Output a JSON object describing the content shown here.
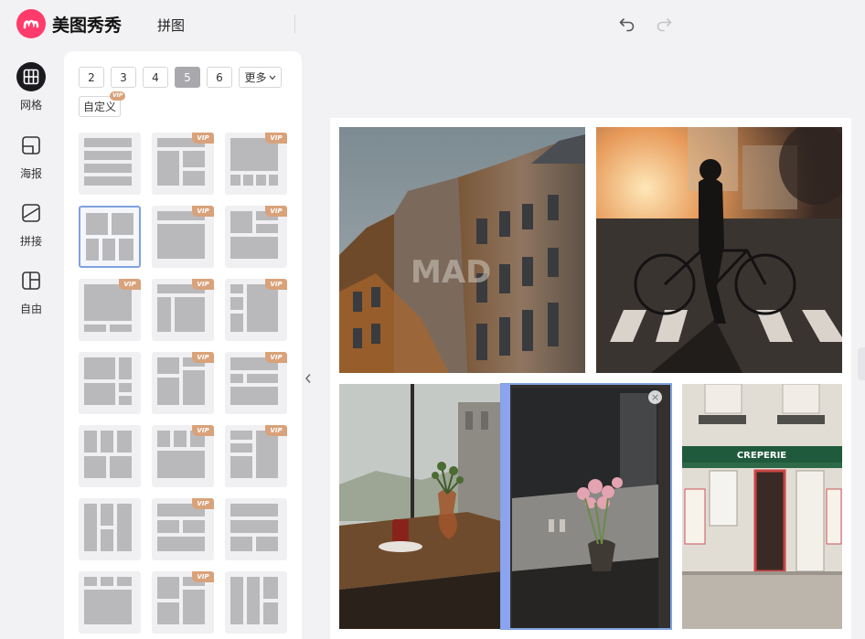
{
  "header": {
    "app_name": "美图秀秀",
    "page_title": "拼图",
    "undo_icon": "undo-icon",
    "redo_icon": "redo-icon",
    "logo_color": "#ff3b6b"
  },
  "nav": {
    "items": [
      {
        "label": "网格",
        "icon": "grid-icon",
        "active": true
      },
      {
        "label": "海报",
        "icon": "poster-icon",
        "active": false
      },
      {
        "label": "拼接",
        "icon": "stitch-icon",
        "active": false
      },
      {
        "label": "自由",
        "icon": "freeform-icon",
        "active": false
      }
    ]
  },
  "panel": {
    "counts": [
      "2",
      "3",
      "4",
      "5",
      "6"
    ],
    "selected_count": "5",
    "more_label": "更多",
    "custom_label": "自定义",
    "vip_label": "VIP",
    "templates": [
      {
        "vip": false,
        "selected": false
      },
      {
        "vip": true,
        "selected": false
      },
      {
        "vip": true,
        "selected": false
      },
      {
        "vip": false,
        "selected": true
      },
      {
        "vip": true,
        "selected": false
      },
      {
        "vip": true,
        "selected": false
      },
      {
        "vip": true,
        "selected": false
      },
      {
        "vip": true,
        "selected": false
      },
      {
        "vip": true,
        "selected": false
      },
      {
        "vip": false,
        "selected": false
      },
      {
        "vip": true,
        "selected": false
      },
      {
        "vip": true,
        "selected": false
      },
      {
        "vip": false,
        "selected": false
      },
      {
        "vip": true,
        "selected": false
      },
      {
        "vip": true,
        "selected": false
      },
      {
        "vip": false,
        "selected": false
      },
      {
        "vip": true,
        "selected": false
      },
      {
        "vip": false,
        "selected": false
      },
      {
        "vip": false,
        "selected": false
      },
      {
        "vip": true,
        "selected": false
      },
      {
        "vip": false,
        "selected": false
      }
    ]
  },
  "canvas": {
    "photos": [
      {
        "name": "photo-street-buildings"
      },
      {
        "name": "photo-cyclist-sunset"
      },
      {
        "name": "photo-cafe-window-table"
      },
      {
        "name": "photo-window-flowers"
      },
      {
        "name": "photo-creperie-storefront"
      }
    ],
    "shop_sign": "CREPERIE",
    "wall_graffiti": "MAD",
    "close_label": "×"
  },
  "colors": {
    "accent": "#7fa2de",
    "vip": "#d9a27a",
    "divider": "#8ca4f0"
  }
}
